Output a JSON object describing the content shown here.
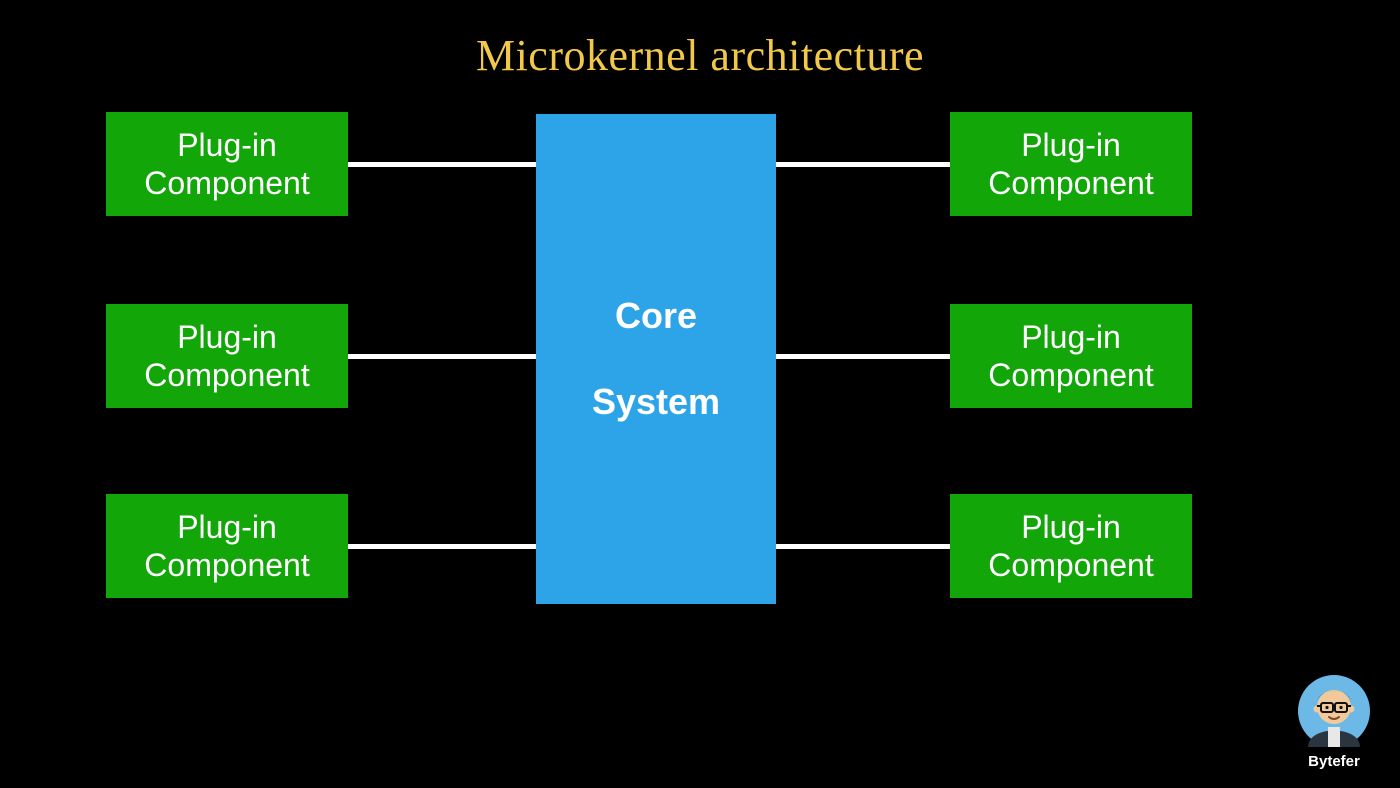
{
  "title": "Microkernel architecture",
  "core": {
    "line1": "Core",
    "line2": "System"
  },
  "plugins_left": [
    {
      "line1": "Plug-in",
      "line2": "Component"
    },
    {
      "line1": "Plug-in",
      "line2": "Component"
    },
    {
      "line1": "Plug-in",
      "line2": "Component"
    }
  ],
  "plugins_right": [
    {
      "line1": "Plug-in",
      "line2": "Component"
    },
    {
      "line1": "Plug-in",
      "line2": "Component"
    },
    {
      "line1": "Plug-in",
      "line2": "Component"
    }
  ],
  "author": {
    "name": "Bytefer"
  },
  "colors": {
    "background": "#000000",
    "title": "#f2c84b",
    "core": "#2ea4e8",
    "plugin": "#12a608",
    "connector": "#ffffff",
    "text": "#ffffff"
  }
}
